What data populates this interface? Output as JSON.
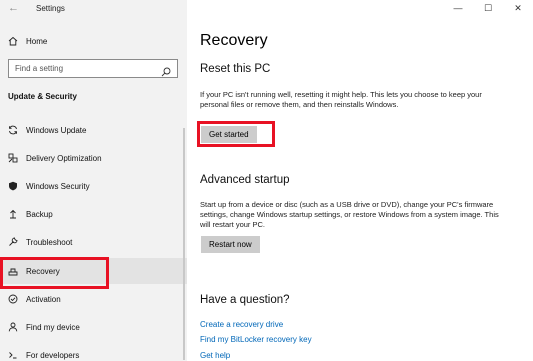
{
  "window": {
    "app_title": "Settings",
    "minimize": "—",
    "maximize": "☐",
    "close": "✕"
  },
  "sidebar": {
    "home_label": "Home",
    "search_placeholder": "Find a setting",
    "section_heading": "Update & Security",
    "items": [
      {
        "label": "Windows Update",
        "icon": "sync-icon"
      },
      {
        "label": "Delivery Optimization",
        "icon": "delivery-icon"
      },
      {
        "label": "Windows Security",
        "icon": "shield-icon"
      },
      {
        "label": "Backup",
        "icon": "backup-icon"
      },
      {
        "label": "Troubleshoot",
        "icon": "wrench-icon"
      },
      {
        "label": "Recovery",
        "icon": "recovery-icon"
      },
      {
        "label": "Activation",
        "icon": "activation-icon"
      },
      {
        "label": "Find my device",
        "icon": "person-icon"
      },
      {
        "label": "For developers",
        "icon": "developer-icon"
      }
    ],
    "selected": "Recovery"
  },
  "main": {
    "page_title": "Recovery",
    "reset": {
      "heading": "Reset this PC",
      "description": "If your PC isn't running well, resetting it might help. This lets you choose to keep your personal files or remove them, and then reinstalls Windows.",
      "button": "Get started"
    },
    "advanced": {
      "heading": "Advanced startup",
      "description": "Start up from a device or disc (such as a USB drive or DVD), change your PC's firmware settings, change Windows startup settings, or restore Windows from a system image. This will restart your PC.",
      "button": "Restart now"
    },
    "question": {
      "heading": "Have a question?",
      "links": [
        "Create a recovery drive",
        "Find my BitLocker recovery key",
        "Get help"
      ]
    }
  },
  "colors": {
    "highlight": "#e81123",
    "link": "#0067b8",
    "sidebar_bg": "#f2f2f2",
    "button_bg": "#cccccc"
  }
}
